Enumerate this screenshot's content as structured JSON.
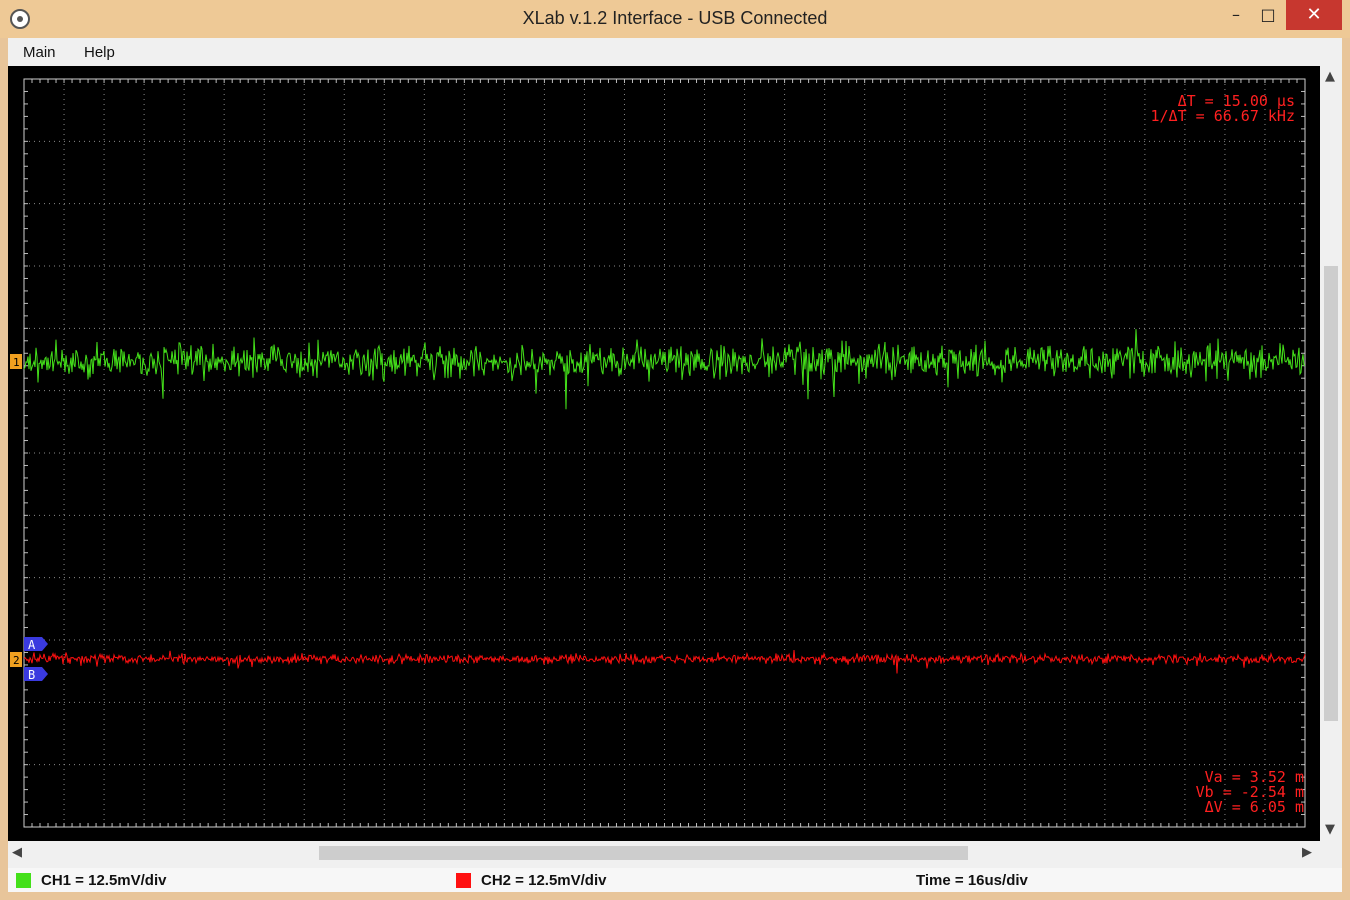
{
  "window": {
    "title": "XLab v.1.2   Interface - USB Connected",
    "minimize": "–",
    "maximize": "□",
    "close": "✕"
  },
  "menu": {
    "items": [
      {
        "label": "Main"
      },
      {
        "label": "Help"
      }
    ]
  },
  "scope": {
    "readout_time": {
      "dt": "ΔT =  15.00 μs",
      "inv_dt": "1/ΔT =  66.67 kHz"
    },
    "readout_voltage": {
      "va": "Va =  3.52 m",
      "vb": "Vb = -2.54 m",
      "dv": "ΔV =  6.05 m"
    },
    "markers": {
      "ch1": "1",
      "ch2": "2",
      "cursor_a": "A",
      "cursor_b": "B"
    },
    "colors": {
      "ch1": "#44e01a",
      "ch2": "#ff1010",
      "readout": "#ff2020",
      "grid": "#8a8a8a",
      "marker": "#f0a020",
      "cursor": "#3a3adf"
    }
  },
  "status": {
    "ch1": "CH1 = 12.5mV/div",
    "ch2": "CH2 = 12.5mV/div",
    "time": "Time = 16us/div"
  }
}
